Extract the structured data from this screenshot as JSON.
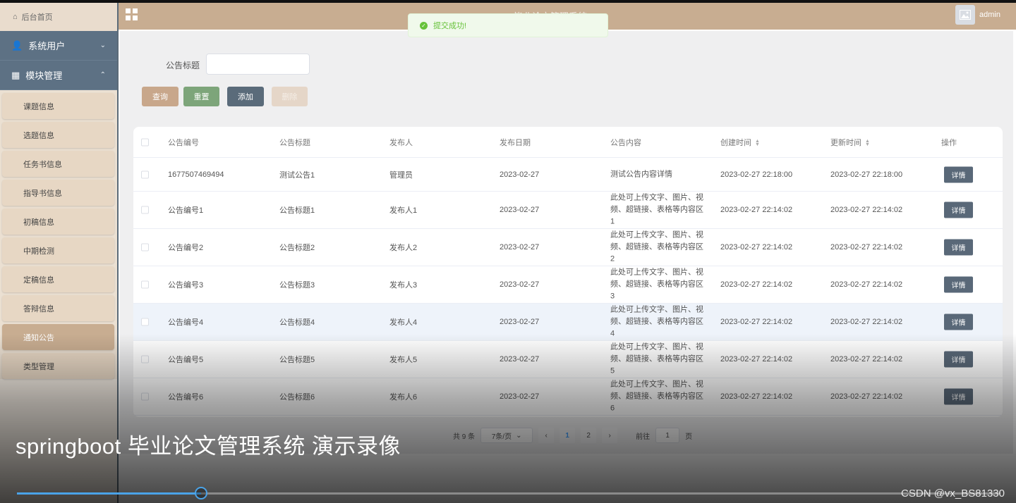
{
  "sidebar": {
    "home": "后台首页",
    "groups": [
      {
        "label": "系统用户",
        "chevron": "⌄"
      },
      {
        "label": "模块管理",
        "chevron": "⌃"
      }
    ],
    "items": [
      {
        "label": "课题信息"
      },
      {
        "label": "选题信息"
      },
      {
        "label": "任务书信息"
      },
      {
        "label": "指导书信息"
      },
      {
        "label": "初稿信息"
      },
      {
        "label": "中期检测"
      },
      {
        "label": "定稿信息"
      },
      {
        "label": "答辩信息"
      },
      {
        "label": "通知公告",
        "active": true
      },
      {
        "label": "类型管理"
      }
    ]
  },
  "header": {
    "title": "毕业论文管理系统",
    "user": "admin"
  },
  "toast": {
    "message": "提交成功!"
  },
  "search": {
    "label": "公告标题",
    "placeholder": ""
  },
  "buttons": {
    "query": "查询",
    "reset": "重置",
    "add": "添加",
    "delete": "删除"
  },
  "table": {
    "columns": [
      "公告编号",
      "公告标题",
      "发布人",
      "发布日期",
      "公告内容",
      "创建时间",
      "更新时间",
      "操作"
    ],
    "action_label": "详情",
    "rows": [
      {
        "id": "1677507469494",
        "title": "测试公告1",
        "publisher": "管理员",
        "date": "2023-02-27",
        "content": "测试公告内容详情",
        "created": "2023-02-27 22:18:00",
        "updated": "2023-02-27 22:18:00"
      },
      {
        "id": "公告编号1",
        "title": "公告标题1",
        "publisher": "发布人1",
        "date": "2023-02-27",
        "content": "此处可上传文字、图片、视频、超链接、表格等内容区1",
        "created": "2023-02-27 22:14:02",
        "updated": "2023-02-27 22:14:02"
      },
      {
        "id": "公告编号2",
        "title": "公告标题2",
        "publisher": "发布人2",
        "date": "2023-02-27",
        "content": "此处可上传文字、图片、视频、超链接、表格等内容区2",
        "created": "2023-02-27 22:14:02",
        "updated": "2023-02-27 22:14:02"
      },
      {
        "id": "公告编号3",
        "title": "公告标题3",
        "publisher": "发布人3",
        "date": "2023-02-27",
        "content": "此处可上传文字、图片、视频、超链接、表格等内容区3",
        "created": "2023-02-27 22:14:02",
        "updated": "2023-02-27 22:14:02"
      },
      {
        "id": "公告编号4",
        "title": "公告标题4",
        "publisher": "发布人4",
        "date": "2023-02-27",
        "content": "此处可上传文字、图片、视频、超链接、表格等内容区4",
        "created": "2023-02-27 22:14:02",
        "updated": "2023-02-27 22:14:02"
      },
      {
        "id": "公告编号5",
        "title": "公告标题5",
        "publisher": "发布人5",
        "date": "2023-02-27",
        "content": "此处可上传文字、图片、视频、超链接、表格等内容区5",
        "created": "2023-02-27 22:14:02",
        "updated": "2023-02-27 22:14:02"
      },
      {
        "id": "公告编号6",
        "title": "公告标题6",
        "publisher": "发布人6",
        "date": "2023-02-27",
        "content": "此处可上传文字、图片、视频、超链接、表格等内容区6",
        "created": "2023-02-27 22:14:02",
        "updated": "2023-02-27 22:14:02"
      }
    ]
  },
  "pagination": {
    "total": "共 9 条",
    "page_size": "7条/页",
    "pages": [
      "1",
      "2"
    ],
    "current": "1",
    "goto_label": "前往",
    "goto_value": "1",
    "goto_suffix": "页"
  },
  "video": {
    "caption": "springboot 毕业论文管理系统 演示录像",
    "watermark": "CSDN @vx_BS81330",
    "progress": 0.187
  },
  "colors": {
    "accent": "#c8ad91",
    "sidebar_group": "#5d7184",
    "detail_button": "#596878",
    "progress": "#4aa3e8"
  }
}
